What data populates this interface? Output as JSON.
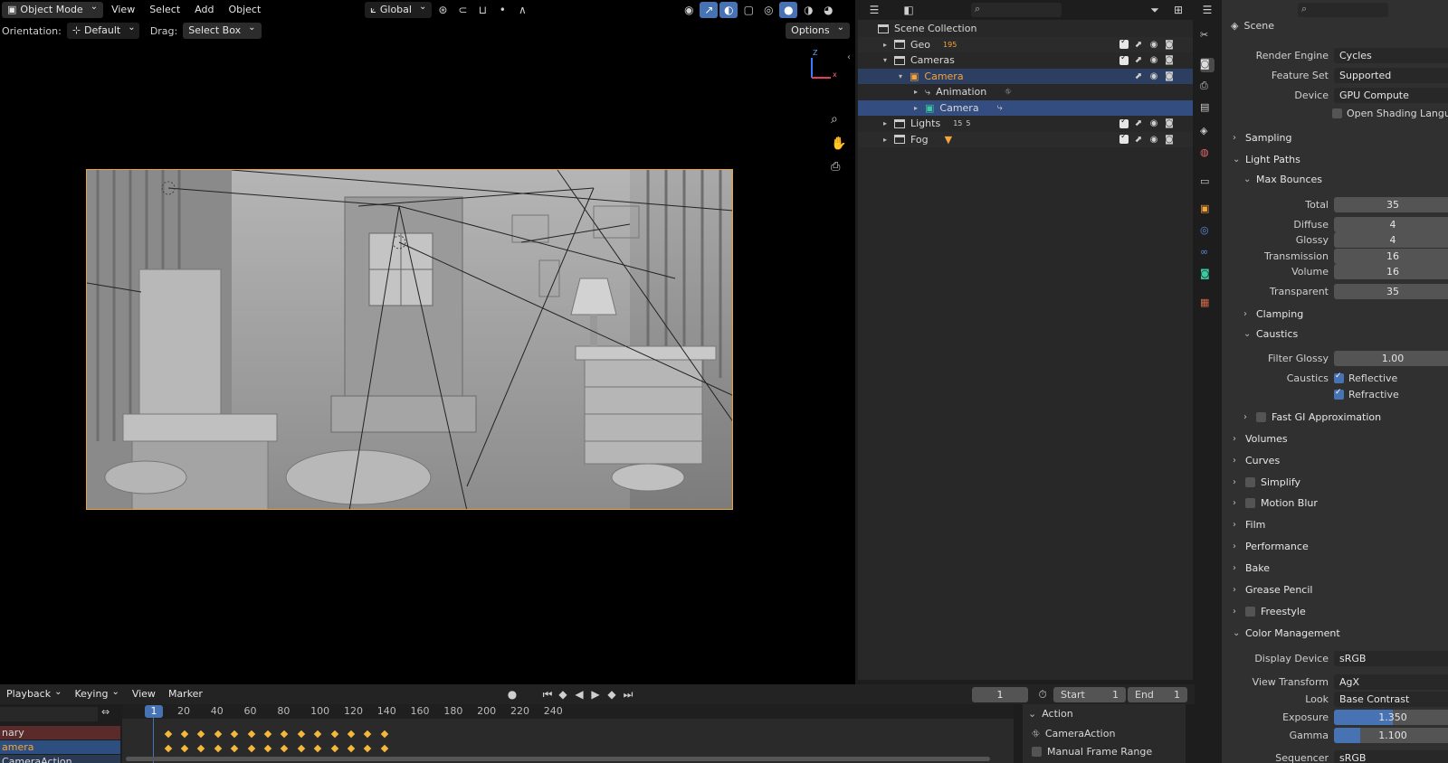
{
  "viewport": {
    "mode": "Object Mode",
    "menus": [
      "View",
      "Select",
      "Add",
      "Object"
    ],
    "transform_orientation": "Global",
    "orientation_label": "Orientation:",
    "orientation_value": "Default",
    "drag_label": "Drag:",
    "drag_value": "Select Box",
    "options": "Options",
    "gizmo_z": "Z",
    "gizmo_x": "x"
  },
  "outliner": {
    "root": "Scene Collection",
    "rows": [
      {
        "label": "Geo",
        "badge": "195"
      },
      {
        "label": "Cameras"
      },
      {
        "label": "Camera"
      },
      {
        "label": "Animation"
      },
      {
        "label": "Camera"
      },
      {
        "label": "Lights",
        "badge": "15",
        "badge2": "5"
      },
      {
        "label": "Fog"
      }
    ]
  },
  "properties": {
    "scene": "Scene",
    "render_engine_label": "Render Engine",
    "render_engine": "Cycles",
    "feature_set_label": "Feature Set",
    "feature_set": "Supported",
    "device_label": "Device",
    "device": "GPU Compute",
    "osl": "Open Shading Language",
    "sampling": "Sampling",
    "light_paths": "Light Paths",
    "max_bounces": "Max Bounces",
    "bounces": [
      {
        "label": "Total",
        "value": "35"
      },
      {
        "label": "Diffuse",
        "value": "4"
      },
      {
        "label": "Glossy",
        "value": "4"
      },
      {
        "label": "Transmission",
        "value": "16"
      },
      {
        "label": "Volume",
        "value": "16"
      },
      {
        "label": "Transparent",
        "value": "35"
      }
    ],
    "clamping": "Clamping",
    "caustics": "Caustics",
    "filter_glossy_label": "Filter Glossy",
    "filter_glossy": "1.00",
    "caustics_label": "Caustics",
    "reflective": "Reflective",
    "refractive": "Refractive",
    "fast_gi": "Fast GI Approximation",
    "sections": [
      "Volumes",
      "Curves",
      "Simplify",
      "Motion Blur",
      "Film",
      "Performance",
      "Bake",
      "Grease Pencil",
      "Freestyle"
    ],
    "color_management": "Color Management",
    "display_device_label": "Display Device",
    "display_device": "sRGB",
    "view_transform_label": "View Transform",
    "view_transform": "AgX",
    "look_label": "Look",
    "look": "Base Contrast",
    "exposure_label": "Exposure",
    "exposure": "1.350",
    "exposure_fill": 0.5,
    "gamma_label": "Gamma",
    "gamma": "1.100",
    "gamma_fill": 0.22,
    "sequencer_label": "Sequencer",
    "sequencer": "sRGB"
  },
  "timeline": {
    "menus": [
      "Playback",
      "Keying",
      "View",
      "Marker"
    ],
    "current_frame": "1",
    "start_label": "Start",
    "start": "1",
    "end_label": "End",
    "end": "1",
    "ruler": [
      "20",
      "40",
      "60",
      "80",
      "100",
      "120",
      "140",
      "160",
      "180",
      "200",
      "220",
      "240"
    ],
    "current_marker": "1",
    "channels": [
      "nary",
      "amera",
      "CameraAction"
    ],
    "action_title": "Action",
    "action_name": "CameraAction",
    "manual_frame_range": "Manual Frame Range"
  },
  "colors": {
    "accent_blue": "#4772b3",
    "selection_blue": "#334d80",
    "keyframe": "#f5b83d",
    "active_orange": "#f5a33d"
  }
}
